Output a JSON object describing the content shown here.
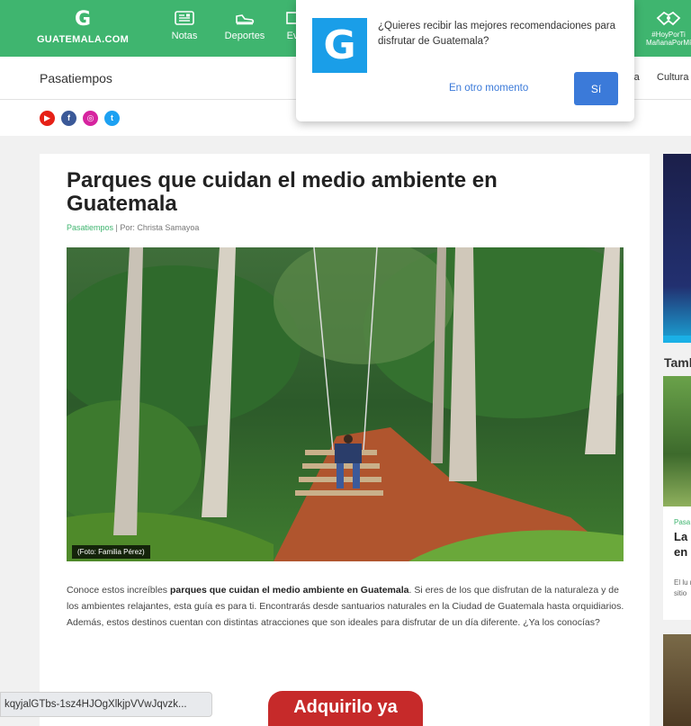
{
  "brand": {
    "letter": "G",
    "name": "GUATEMALA.COM"
  },
  "nav": {
    "items": [
      {
        "label": "Notas",
        "icon": "newspaper-icon"
      },
      {
        "label": "Deportes",
        "icon": "sneaker-icon"
      },
      {
        "label": "Ev",
        "icon": "calendar-icon"
      }
    ],
    "campaign": {
      "line1": "#HoyPorTi",
      "line2": "MañanaPorMí"
    }
  },
  "subbar": {
    "section_title": "Pasatiempos",
    "categories": [
      "ra",
      "Cultura"
    ]
  },
  "social": [
    {
      "name": "youtube",
      "color": "#e62117",
      "glyph": "▶"
    },
    {
      "name": "facebook",
      "color": "#3b5998",
      "glyph": "f"
    },
    {
      "name": "instagram",
      "color": "#d6249f",
      "glyph": "◎"
    },
    {
      "name": "twitter",
      "color": "#1da1f2",
      "glyph": "t"
    }
  ],
  "article": {
    "title": "Parques que cuidan el medio ambiente en Guatemala",
    "category": "Pasatiempos",
    "separator": " | ",
    "byline": "Por: Christa Samayoa",
    "photo_caption": "(Foto: Familia Pérez)",
    "body_before": "Conoce estos increíbles ",
    "body_bold": "parques que cuidan el medio ambiente en Guatemala",
    "body_after": ". Si eres de los que disfrutan de la naturaleza y de los ambientes relajantes, esta guía es para ti. Encontrarás desde santuarios naturales en la Ciudad de Guatemala hasta orquidiarios. Además, estos destinos cuentan con distintas atracciones que son ideales para disfrutar de un día diferente. ¿Ya los conocías?",
    "ad_button": "Adquirilo ya"
  },
  "rail": {
    "heading": "Tamb",
    "card": {
      "category": "Pasa",
      "title": "La nu en",
      "description": "El lu nue sitio"
    }
  },
  "popup": {
    "logo_letter": "G",
    "message": "¿Quieres recibir las mejores recomendaciones para disfrutar de Guatemala?",
    "later_label": "En otro momento",
    "yes_label": "Sí"
  },
  "status_url": "kqyjalGTbs-1sz4HJOgXlkjpVVwJqvzk..."
}
